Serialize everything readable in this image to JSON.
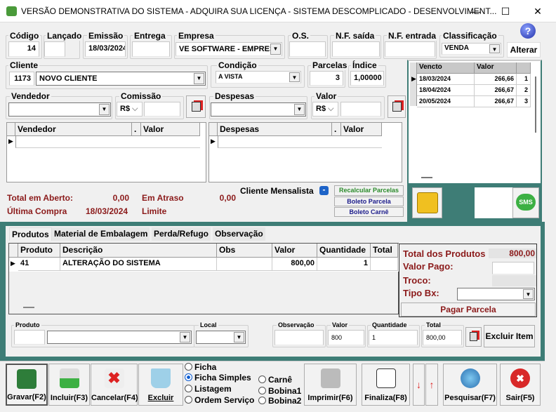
{
  "window": {
    "title": "VERSÃO DEMONSTRATIVA DO SISTEMA - ADQUIRA SUA LICENÇA - SISTEMA DESCOMPLICADO - DESENVOLVIMENT...",
    "minimize": "—",
    "maximize": "☐",
    "close": "✕"
  },
  "header": {
    "codigo": {
      "label": "Código",
      "value": "14"
    },
    "lancado": {
      "label": "Lançado",
      "value": ""
    },
    "emissao": {
      "label": "Emissão",
      "value": "18/03/2024"
    },
    "entrega": {
      "label": "Entrega",
      "value": ""
    },
    "empresa": {
      "label": "Empresa",
      "value": "VE SOFTWARE - EMPRESA"
    },
    "os": {
      "label": "O.S.",
      "value": ""
    },
    "nf_saida": {
      "label": "N.F. saída",
      "value": ""
    },
    "nf_entrada": {
      "label": "N.F. entrada",
      "value": ""
    },
    "classificacao": {
      "label": "Classificação",
      "value": "VENDA"
    },
    "help": "?",
    "alterar": "Alterar"
  },
  "cliente": {
    "label": "Cliente",
    "code": "1173",
    "name": "NOVO CLIENTE"
  },
  "condicao": {
    "label": "Condição",
    "value": "A VISTA"
  },
  "parcelas": {
    "label": "Parcelas",
    "value": "3"
  },
  "indice": {
    "label": "Índice",
    "value": "1,00000"
  },
  "installments": {
    "headers": [
      "Vencto",
      "Valor",
      ""
    ],
    "rows": [
      [
        "18/03/2024",
        "266,66",
        "1"
      ],
      [
        "18/04/2024",
        "266,67",
        "2"
      ],
      [
        "20/05/2024",
        "266,67",
        "3"
      ]
    ]
  },
  "vendedor": {
    "label": "Vendedor",
    "value": ""
  },
  "comissao": {
    "label": "Comissão",
    "currency": "R$",
    "value": ""
  },
  "despesas": {
    "label": "Despesas",
    "value": ""
  },
  "valor": {
    "label": "Valor",
    "currency": "R$",
    "value": ""
  },
  "vendedor_grid": {
    "headers": [
      "Vendedor",
      ".",
      "Valor"
    ]
  },
  "despesas_grid": {
    "headers": [
      "Despesas",
      ".",
      "Valor"
    ]
  },
  "totals": {
    "total_aberto_label": "Total em Aberto:",
    "total_aberto": "0,00",
    "em_atraso_label": "Em Atraso",
    "em_atraso": "0,00",
    "ultima_compra_label": "Última Compra",
    "ultima_compra": "18/03/2024",
    "limite_label": "Limite",
    "limite": ""
  },
  "cliente_mensalista": "Cliente Mensalista",
  "actions": {
    "recalcular": "Recalcular Parcelas",
    "boleto_parcela": "Boleto Parcela",
    "boleto_carne": "Boleto Carnê",
    "sms": "SMS"
  },
  "tabs": [
    "Produtos",
    "Material de Embalagem",
    "Perda/Refugo",
    "Observação"
  ],
  "products": {
    "headers": [
      "Produto",
      "Descrição",
      "Obs",
      "Valor",
      "Quantidade",
      "Total"
    ],
    "rows": [
      [
        "41",
        "ALTERAÇÃO DO SISTEMA",
        "",
        "800,00",
        "1",
        ""
      ]
    ]
  },
  "summary": {
    "total_produtos_label": "Total dos Produtos",
    "total_produtos": "800,00",
    "valor_pago_label": "Valor Pago:",
    "troco_label": "Troco:",
    "tipo_bx_label": "Tipo Bx:",
    "pagar": "Pagar Parcela"
  },
  "item": {
    "produto_label": "Produto",
    "local_label": "Local",
    "obs_label": "Observação",
    "valor_label": "Valor",
    "valor": "800",
    "qtd_label": "Quantidade",
    "qtd": "1",
    "total_label": "Total",
    "total": "800,00",
    "excluir": "Excluir Item"
  },
  "toolbar": {
    "gravar": "Gravar(F2)",
    "incluir": "Incluir(F3)",
    "cancelar": "Cancelar(F4)",
    "excluir": "Excluir",
    "imprimir": "Imprimir(F6)",
    "finaliza": "Finaliza(F8)",
    "pesquisar": "Pesquisar(F7)",
    "sair": "Sair(F5)"
  },
  "print_options": {
    "ficha": "Ficha",
    "ficha_simples": "Ficha Simples",
    "listagem": "Listagem",
    "ordem_servico": "Ordem Serviço",
    "carne": "Carnê",
    "bobina1": "Bobina1",
    "bobina2": "Bobina2",
    "selected": "Ficha Simples"
  }
}
